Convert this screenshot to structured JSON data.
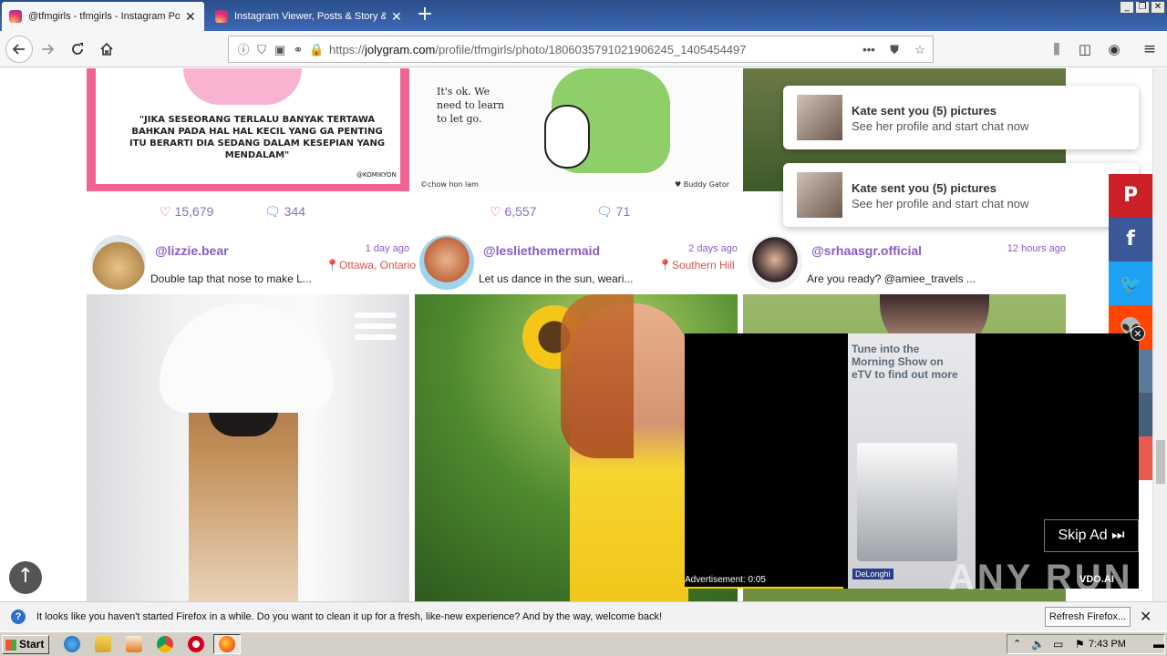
{
  "browser": {
    "tabs": [
      {
        "title": "@tfmgirls - tfmgirls - Instagram Po",
        "active": true
      },
      {
        "title": "Instagram Viewer, Posts & Story &",
        "active": false
      }
    ],
    "url_prefix": "https://",
    "url_domain": "jolygram.com",
    "url_path": "/profile/tfmgirls/photo/1806035791021906245_1405454497",
    "page_actions_icon": "•••"
  },
  "posts_top": [
    {
      "likes": "15,679",
      "comments": "344",
      "quote": "\"JIKA SESEORANG TERLALU BANYAK TERTAWA BAHKAN PADA HAL HAL KECIL YANG GA PENTING ITU BERARTI DIA SEDANG DALAM KESEPIAN YANG MENDALAM\"",
      "credit": "@KOMIKYON"
    },
    {
      "likes": "6,557",
      "comments": "71",
      "bubble_text": "It's ok. We need to learn to let go.",
      "credit_left": "©chow hon lam",
      "credit_right": "♥ Buddy Gator"
    }
  ],
  "posts_row2": [
    {
      "username": "@lizzie.bear",
      "time": "1 day ago",
      "location": "Ottawa, Ontario",
      "caption": "Double tap that nose to make L..."
    },
    {
      "username": "@lesliethemermaid",
      "time": "2 days ago",
      "location": "Southern Hill F",
      "caption": "Let us dance in the sun, weari..."
    },
    {
      "username": "@srhaasgr.official",
      "time": "12 hours ago",
      "location": "",
      "caption": "Are you ready? @amiee_travels ..."
    }
  ],
  "notifications": [
    {
      "title": "Kate sent you (5) pictures",
      "subtitle": "See her profile and start chat now"
    },
    {
      "title": "Kate sent you (5) pictures",
      "subtitle": "See her profile and start chat now"
    }
  ],
  "share_bar": {
    "items": [
      "P",
      "f",
      "🐦",
      "👽",
      "",
      ""
    ],
    "colors": [
      "#cb2027",
      "#3b5998",
      "#1da1f2",
      "#ff4500",
      "#5a7a9a",
      "#e85a4f"
    ]
  },
  "ad": {
    "creative_text": "Tune into the Morning Show on eTV to find out more",
    "brand": "DeLonghi",
    "label": "Advertisement: 0:05",
    "skip": "Skip Ad",
    "vdo": "VDO.AI",
    "progress": 0.35
  },
  "ff_notice": {
    "message": "It looks like you haven't started Firefox in a while. Do you want to clean it up for a fresh, like-new experience? And by the way, welcome back!",
    "button": "Refresh Firefox..."
  },
  "taskbar": {
    "start": "Start",
    "clock": "7:43 PM"
  },
  "watermark": "ANY RUN"
}
